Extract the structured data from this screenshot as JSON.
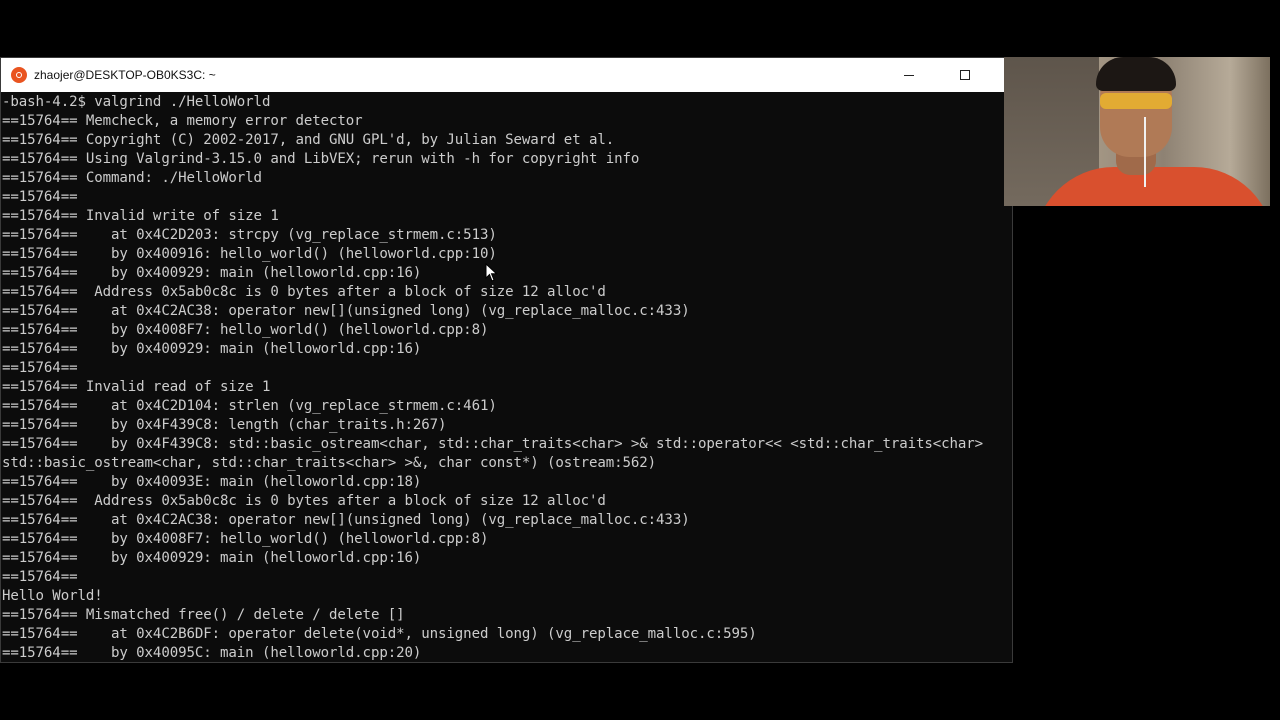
{
  "window": {
    "title": "zhaojer@DESKTOP-OB0KS3C: ~",
    "app_icon": "ubuntu-icon",
    "controls": {
      "minimize_icon": "minimize-icon",
      "maximize_icon": "maximize-icon"
    }
  },
  "terminal": {
    "text_color": "#cccccc",
    "background": "#0c0c0c",
    "lines": [
      "-bash-4.2$ valgrind ./HelloWorld",
      "==15764== Memcheck, a memory error detector",
      "==15764== Copyright (C) 2002-2017, and GNU GPL'd, by Julian Seward et al.",
      "==15764== Using Valgrind-3.15.0 and LibVEX; rerun with -h for copyright info",
      "==15764== Command: ./HelloWorld",
      "==15764==",
      "==15764== Invalid write of size 1",
      "==15764==    at 0x4C2D203: strcpy (vg_replace_strmem.c:513)",
      "==15764==    by 0x400916: hello_world() (helloworld.cpp:10)",
      "==15764==    by 0x400929: main (helloworld.cpp:16)",
      "==15764==  Address 0x5ab0c8c is 0 bytes after a block of size 12 alloc'd",
      "==15764==    at 0x4C2AC38: operator new[](unsigned long) (vg_replace_malloc.c:433)",
      "==15764==    by 0x4008F7: hello_world() (helloworld.cpp:8)",
      "==15764==    by 0x400929: main (helloworld.cpp:16)",
      "==15764==",
      "==15764== Invalid read of size 1",
      "==15764==    at 0x4C2D104: strlen (vg_replace_strmem.c:461)",
      "==15764==    by 0x4F439C8: length (char_traits.h:267)",
      "==15764==    by 0x4F439C8: std::basic_ostream<char, std::char_traits<char> >& std::operator<< <std::char_traits<char>",
      "std::basic_ostream<char, std::char_traits<char> >&, char const*) (ostream:562)",
      "==15764==    by 0x40093E: main (helloworld.cpp:18)",
      "==15764==  Address 0x5ab0c8c is 0 bytes after a block of size 12 alloc'd",
      "==15764==    at 0x4C2AC38: operator new[](unsigned long) (vg_replace_malloc.c:433)",
      "==15764==    by 0x4008F7: hello_world() (helloworld.cpp:8)",
      "==15764==    by 0x400929: main (helloworld.cpp:16)",
      "==15764==",
      "Hello World!",
      "==15764== Mismatched free() / delete / delete []",
      "==15764==    at 0x4C2B6DF: operator delete(void*, unsigned long) (vg_replace_malloc.c:595)",
      "==15764==    by 0x40095C: main (helloworld.cpp:20)"
    ]
  },
  "cursor_icon": "mouse-pointer-icon",
  "webcam_icon": "webcam-overlay"
}
